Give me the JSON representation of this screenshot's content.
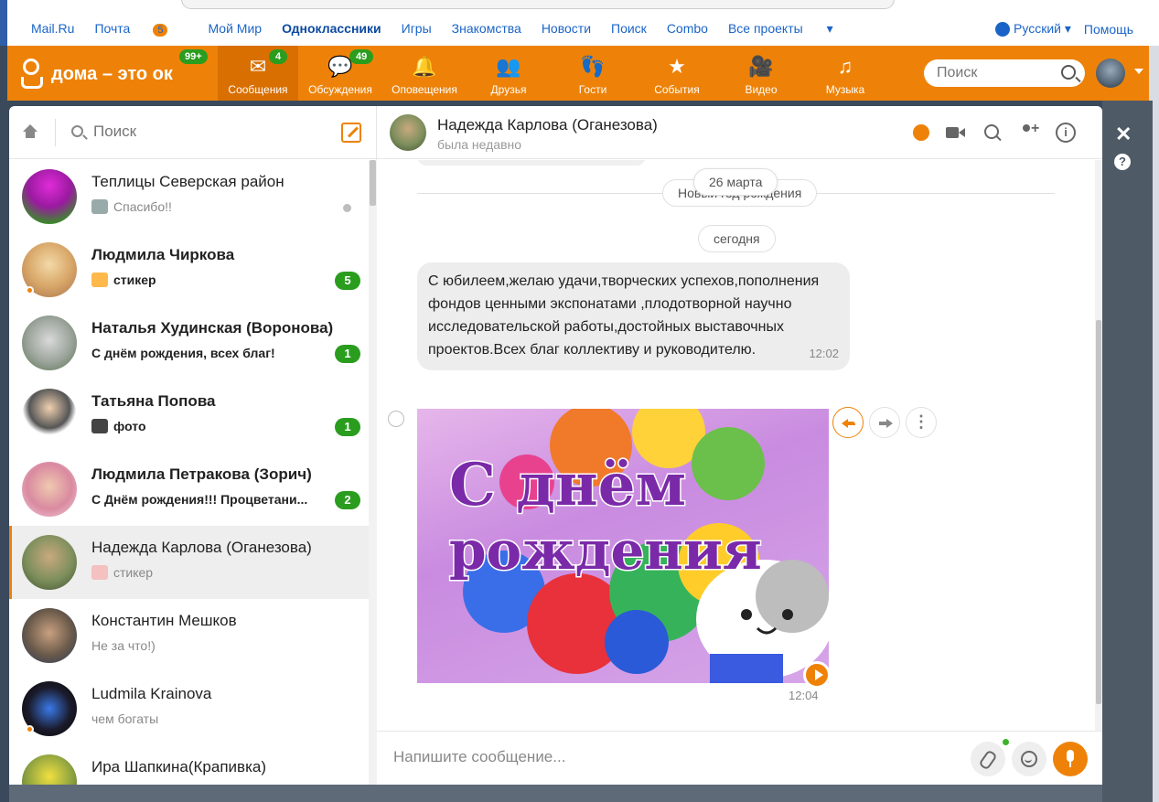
{
  "portal": {
    "links": [
      "Mail.Ru",
      "Почта",
      "Мой Мир",
      "Одноклассники",
      "Игры",
      "Знакомства",
      "Новости",
      "Поиск",
      "Combo",
      "Все проекты"
    ],
    "mail_badge": "5",
    "language": "Русский",
    "help": "Помощь"
  },
  "header": {
    "logo_text": "дома – это ок",
    "logo_badge": "99+",
    "nav": [
      {
        "label": "Сообщения",
        "badge": "4",
        "icon": "envelope-icon",
        "active": true
      },
      {
        "label": "Обсуждения",
        "badge": "49",
        "icon": "chat-bubbles-icon"
      },
      {
        "label": "Оповещения",
        "badge": "",
        "icon": "bell-icon"
      },
      {
        "label": "Друзья",
        "badge": "",
        "icon": "people-icon"
      },
      {
        "label": "Гости",
        "badge": "",
        "icon": "footprints-icon"
      },
      {
        "label": "События",
        "badge": "",
        "icon": "events-icon"
      },
      {
        "label": "Видео",
        "badge": "",
        "icon": "video-camera-icon"
      },
      {
        "label": "Музыка",
        "badge": "",
        "icon": "music-note-icon"
      }
    ],
    "search_placeholder": "Поиск"
  },
  "chatlist": {
    "search_placeholder": "Поиск",
    "items": [
      {
        "name": "Теплицы Северская район",
        "preview": "Спасибо!!",
        "unread": "",
        "bold": false
      },
      {
        "name": "Людмила Чиркова",
        "preview": "стикер",
        "unread": "5",
        "bold": true
      },
      {
        "name": "Наталья Худинская (Воронова)",
        "preview": "С днём рождения, всех благ!",
        "unread": "1",
        "bold": true
      },
      {
        "name": "Татьяна Попова",
        "preview": "фото",
        "unread": "1",
        "bold": true
      },
      {
        "name": "Людмила Петракова (Зорич)",
        "preview": "С Днём рождения!!! Процветани...",
        "unread": "2",
        "bold": true
      },
      {
        "name": "Надежда Карлова (Оганезова)",
        "preview": "стикер",
        "unread": "",
        "bold": false
      },
      {
        "name": "Константин Мешков",
        "preview": "Не за что!)",
        "unread": "",
        "bold": false
      },
      {
        "name": "Ludmila Krainova",
        "preview": "чем богаты",
        "unread": "",
        "bold": false
      },
      {
        "name": "Ира Шапкина(Крапивка)",
        "preview": "",
        "unread": "",
        "bold": false
      }
    ]
  },
  "conversation": {
    "name": "Надежда Карлова (Оганезова)",
    "status": "была недавно",
    "date_under": "Новый год рождения",
    "date_top": "26 марта",
    "date_today": "сегодня",
    "message_text": "С юбилеем,желаю удачи,творческих успехов,пополнения фондов ценными экспонатами ,плодотворной научно исследовательской работы,достойных выставочных проектов.Всех благ коллективу и руководителю.",
    "message_time": "12:02",
    "sticker_text_line1": "С днём",
    "sticker_text_line2": "рождения",
    "sticker_time": "12:04",
    "input_placeholder": "Напишите сообщение..."
  },
  "colors": {
    "brand_orange": "#ee8208",
    "badge_green": "#2a9d1e",
    "link_blue": "#1a64c8"
  }
}
